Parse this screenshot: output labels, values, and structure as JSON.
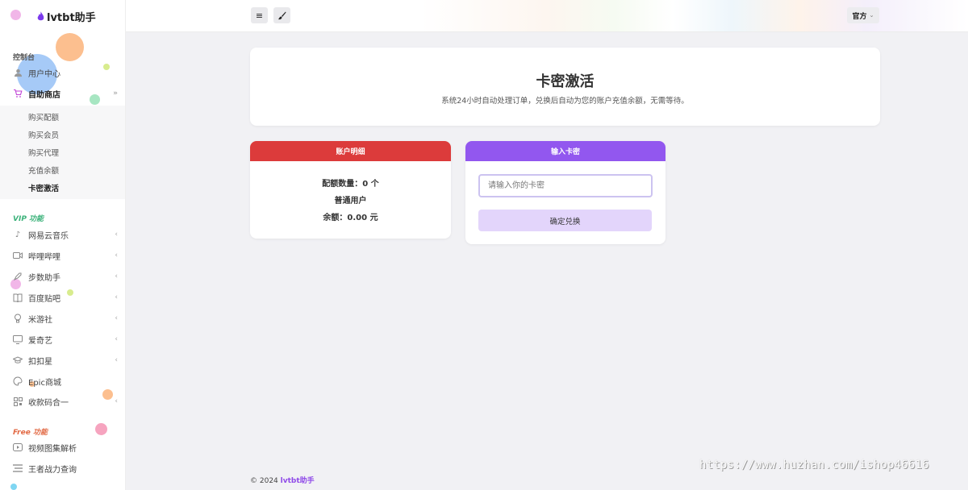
{
  "app": {
    "name": "lvtbt助手"
  },
  "sidebar": {
    "console_label": "控制台",
    "console_items": [
      {
        "label": "用户中心",
        "icon": "user-icon"
      },
      {
        "label": "自助商店",
        "icon": "cart-icon",
        "expanded": true
      }
    ],
    "shop_submenu": [
      "购买配额",
      "购买会员",
      "购买代理",
      "充值余额",
      "卡密激活"
    ],
    "shop_submenu_current": "卡密激活",
    "vip_label": "VIP 功能",
    "vip_items": [
      {
        "label": "网易云音乐",
        "icon": "music-note-icon"
      },
      {
        "label": "哔哩哔哩",
        "icon": "video-icon"
      },
      {
        "label": "步数助手",
        "icon": "rocket-icon"
      },
      {
        "label": "百度贴吧",
        "icon": "book-icon"
      },
      {
        "label": "米游社",
        "icon": "bulb-icon"
      },
      {
        "label": "爱奇艺",
        "icon": "monitor-icon"
      },
      {
        "label": "扣扣星",
        "icon": "graduation-icon"
      },
      {
        "label": "Epic商城",
        "icon": "palette-icon"
      },
      {
        "label": "收款码合一",
        "icon": "qrcode-icon"
      }
    ],
    "free_label": "Free 功能",
    "free_items": [
      {
        "label": "视频图集解析",
        "icon": "play-icon"
      },
      {
        "label": "王者战力查询",
        "icon": "list-icon"
      }
    ]
  },
  "topbar": {
    "menu_toggle_icon": "menu-icon",
    "theme_icon": "brush-icon",
    "source_select": "官方"
  },
  "hero": {
    "title": "卡密激活",
    "subtitle": "系统24小时自动处理订单，兑换后自动为您的账户充值余额，无需等待。"
  },
  "account": {
    "header": "账户明细",
    "quota": "配额数量：0 个",
    "role": "普通用户",
    "balance": "余额：0.00 元"
  },
  "redeem": {
    "header": "输入卡密",
    "input_value": "",
    "input_placeholder": "请输入你的卡密",
    "submit_label": "确定兑换"
  },
  "footer": {
    "copyright": "© 2024 ",
    "brand": "lvtbt助手"
  },
  "watermark": "https://www.huzhan.com/ishop46616",
  "colors": {
    "account_header": "#dc3b3b",
    "redeem_header": "#9257ef",
    "confirm_button": "#e3d5fb",
    "brand": "#8f4ae8"
  }
}
